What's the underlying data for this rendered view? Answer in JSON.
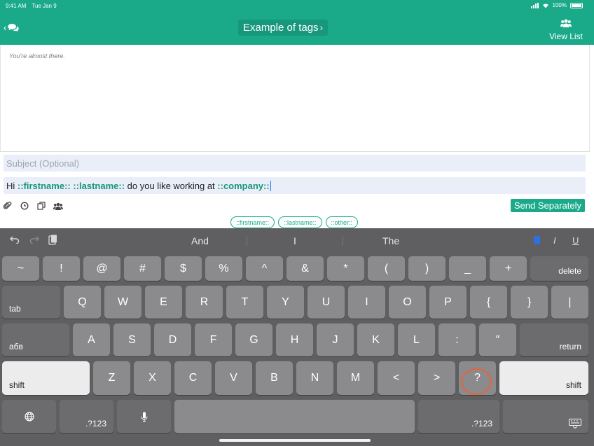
{
  "status": {
    "time": "9:41 AM",
    "date": "Tue Jan 9",
    "battery": "100%"
  },
  "nav": {
    "title": "Example of tags",
    "title_chevron": "›",
    "back_chevron": "‹",
    "view_list": "View List"
  },
  "conversation": {
    "hint": "You're almost there."
  },
  "compose": {
    "subject_placeholder": "Subject (Optional)",
    "message": {
      "t1": "Hi ",
      "tag1": "::firstname::",
      "t2": " ",
      "tag2": "::lastname::",
      "t3": " do you like working at ",
      "tag3": "::company::"
    },
    "send_label": "Send Separately",
    "tags": [
      "::firstname::",
      "::lastname::",
      "::other::"
    ]
  },
  "keyboard": {
    "predictions": [
      "And",
      "I",
      "The"
    ],
    "format": {
      "italic": "I",
      "underline": "U"
    },
    "row1": [
      "~",
      "!",
      "@",
      "#",
      "$",
      "%",
      "^",
      "&",
      "*",
      "(",
      ")",
      "_",
      "+"
    ],
    "delete": "delete",
    "tab": "tab",
    "row2": [
      "Q",
      "W",
      "E",
      "R",
      "T",
      "Y",
      "U",
      "I",
      "O",
      "P",
      "{",
      "}",
      "|"
    ],
    "lang": "абв",
    "row3": [
      "A",
      "S",
      "D",
      "F",
      "G",
      "H",
      "J",
      "K",
      "L",
      ":",
      "″"
    ],
    "return": "return",
    "shift": "shift",
    "row4": [
      "Z",
      "X",
      "C",
      "V",
      "B",
      "N",
      "M",
      "<",
      ">",
      "?"
    ],
    "numbers": ".?123"
  }
}
